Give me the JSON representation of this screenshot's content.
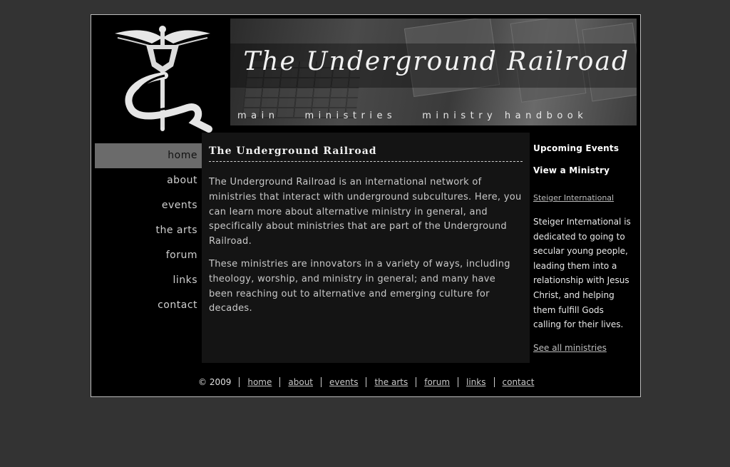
{
  "site": {
    "title": "The Underground Railroad"
  },
  "logo": {
    "icon": "winged-caduceus-logo-icon"
  },
  "top_nav": [
    {
      "label": "main"
    },
    {
      "label": "ministries"
    },
    {
      "label": "ministry handbook"
    }
  ],
  "left_nav": [
    {
      "label": "home",
      "active": true
    },
    {
      "label": "about"
    },
    {
      "label": "events"
    },
    {
      "label": "the arts"
    },
    {
      "label": "forum"
    },
    {
      "label": "links"
    },
    {
      "label": "contact"
    }
  ],
  "main": {
    "title": "The Underground Railroad",
    "paragraphs": [
      "The Underground Railroad is an international network of ministries that interact with underground subcultures. Here, you can learn more about alternative ministry in general, and specifically about ministries that are part of the Underground Railroad.",
      "These ministries are innovators in a variety of ways, including theology, worship, and ministry in general; and many have been reaching out to alternative and emerging culture for decades."
    ]
  },
  "sidebar": {
    "upcoming_events": "Upcoming Events",
    "view_ministry": "View a Ministry",
    "ministry_link": "Steiger International",
    "ministry_desc": "Steiger International is dedicated to going to secular young people, leading them into a relationship with Jesus Christ, and helping them fulfill Gods calling for their lives.",
    "see_all": "See all ministries"
  },
  "footer": {
    "copyright": "© 2009",
    "links": [
      "home",
      "about",
      "events",
      "the arts",
      "forum",
      "links",
      "contact"
    ]
  },
  "colors": {
    "page_bg": "#333333",
    "frame_bg": "#000000",
    "content_bg": "#141414",
    "active_nav_bg": "#6b6b6b"
  }
}
